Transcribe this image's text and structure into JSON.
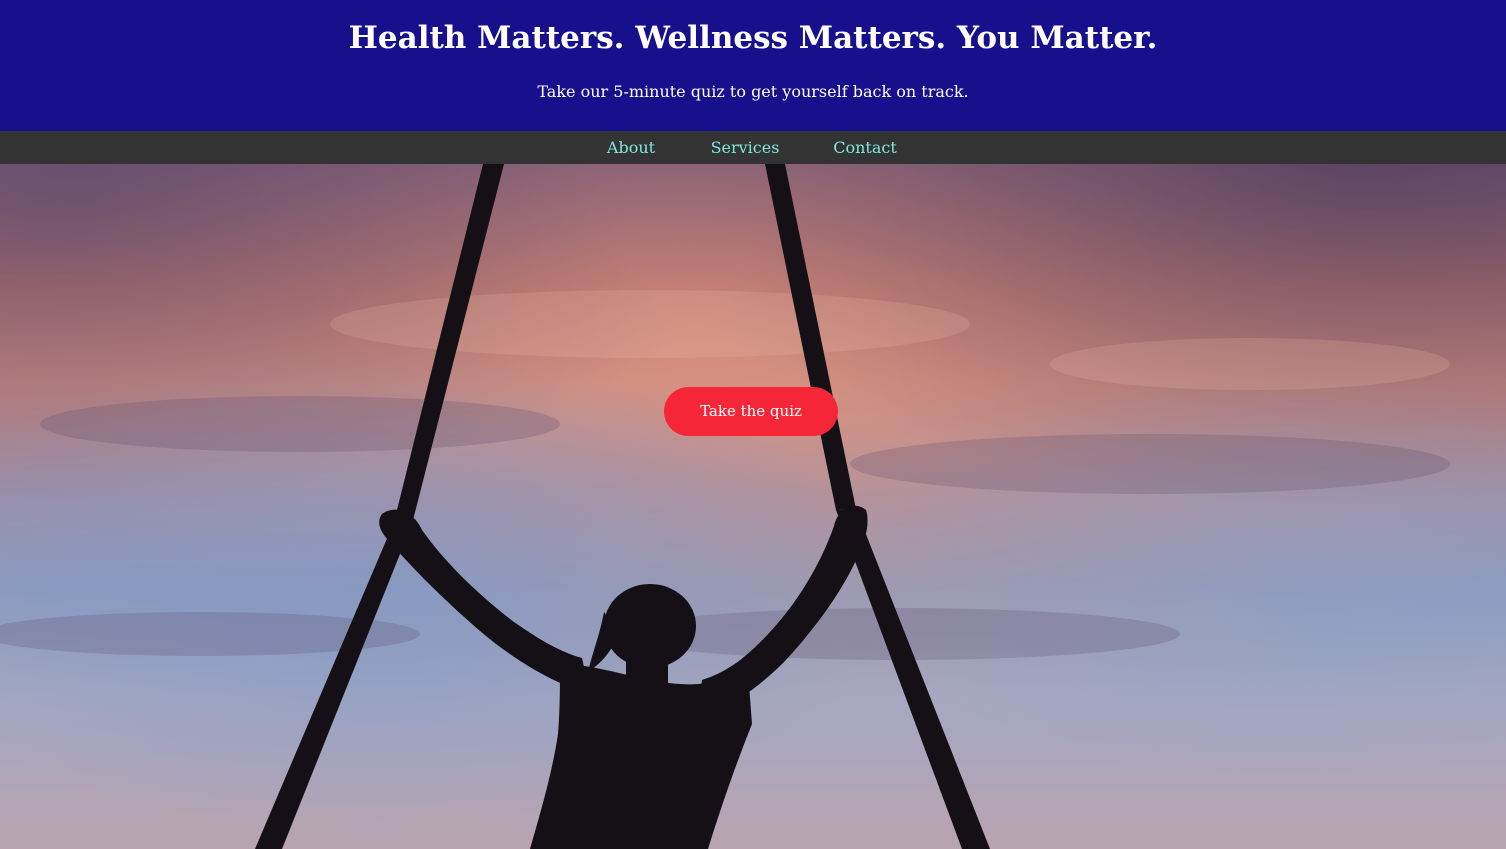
{
  "header": {
    "title": "Health Matters. Wellness Matters. You Matter.",
    "subtitle": "Take our 5-minute quiz to get yourself back on track."
  },
  "nav": {
    "items": [
      {
        "label": "About"
      },
      {
        "label": "Services"
      },
      {
        "label": "Contact"
      }
    ]
  },
  "hero": {
    "image_description": "silhouette-aerial-silks-sunset-sky",
    "cta_label": "Take the quiz"
  },
  "colors": {
    "header_bg": "#16108c",
    "nav_bg": "#333333",
    "nav_link": "#7fe7e0",
    "cta_bg": "#f42638",
    "text_light": "#ffffff"
  }
}
